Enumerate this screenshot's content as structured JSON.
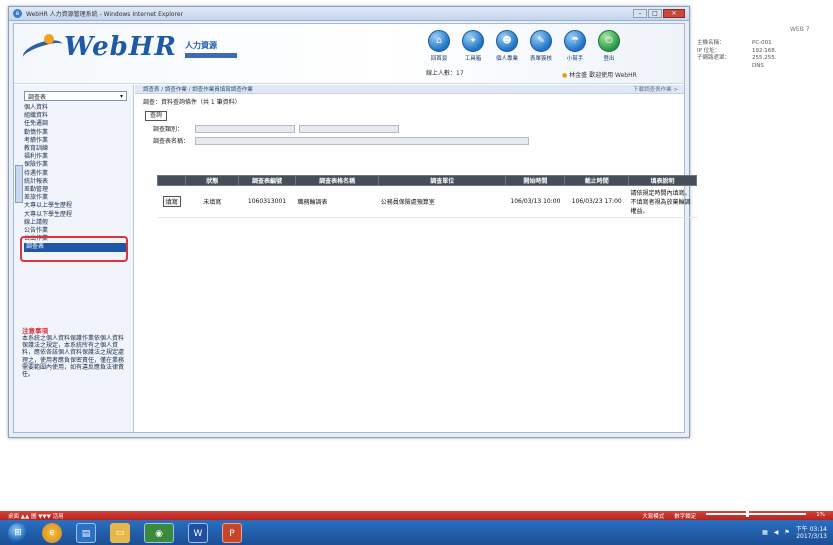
{
  "window": {
    "title": "WebHR 人力資源管理系統 - Windows Internet Explorer"
  },
  "header": {
    "brand": "WebHR",
    "brand_sub": "人力資源",
    "online_text": "線上人數：17",
    "user_text": "林金盛 歡迎使用 WebHR"
  },
  "top_icons": [
    {
      "label": "回首頁",
      "icon": "home-icon"
    },
    {
      "label": "工具箱",
      "icon": "toolbox-icon"
    },
    {
      "label": "個人專業",
      "icon": "person-icon"
    },
    {
      "label": "表單簽核",
      "icon": "form-icon"
    },
    {
      "label": "小幫手",
      "icon": "helper-icon"
    },
    {
      "label": "登出",
      "icon": "logout-icon"
    }
  ],
  "sidebar": {
    "select_value": "調查表",
    "menu": [
      "個人資料",
      "組織資料",
      "任免遷調",
      "勤惰作業",
      "考績作業",
      "教育訓練",
      "福利作業",
      "保險作業",
      "待遇作業",
      "統計報表",
      "差勤管理",
      "差旅作業",
      "大專以上學生歷程",
      "大專以下學生歷程",
      "線上請假",
      "公告作業",
      "公出作業",
      "調查表"
    ],
    "active_index": 17,
    "note_title": "注意事項",
    "note_body": "本系統之個人資料保護作業依個人資料保護法之規定，本系統所有之個人資料，應依各該個人資料保護法之規定處理之，使用者應負保密責任，僅在業務需要範圍內使用，如有違反應負法律責任。"
  },
  "main": {
    "breadcrumb": "調查表 / 調查作業 / 調查作業員填寫調查作業",
    "breadcrumb_right": "下載調查表作業 >",
    "page_title": "調查：資料查詢條件（共 1 筆資料）",
    "query_button": "查詢",
    "filter1_label": "調查類別：",
    "filter2_label": "調查表名稱：",
    "columns": [
      "",
      "狀態",
      "調查表編號",
      "調查表格名稱",
      "調查單位",
      "開始時間",
      "截止時間",
      "填表說明"
    ],
    "rows": [
      {
        "action": "填寫",
        "status": "未填寫",
        "code": "1060313001",
        "name": "職務輪調表",
        "unit": "公務員保險處預算室",
        "start": "106/03/13 10:00",
        "end": "106/03/23 17:00",
        "desc": "請依規定時間內填寫。不填寫者視為放棄輪調權益。"
      }
    ]
  },
  "desktop": {
    "top_right": "WEB 7",
    "col1": [
      "主機名稱：",
      "IP 位址：",
      "子網路遮罩："
    ],
    "col2": [
      "PC-001",
      "192.168.",
      "255.255."
    ],
    "col3": [
      "",
      "",
      "DNS"
    ]
  },
  "taskbar_top": {
    "left": "桌面 ▲▲  圖 ▼▼▼  活用",
    "right": [
      "大寫模式",
      "數字鎖定",
      "1%"
    ]
  },
  "clock": {
    "time": "下午 03:14",
    "date": "2017/3/13"
  }
}
